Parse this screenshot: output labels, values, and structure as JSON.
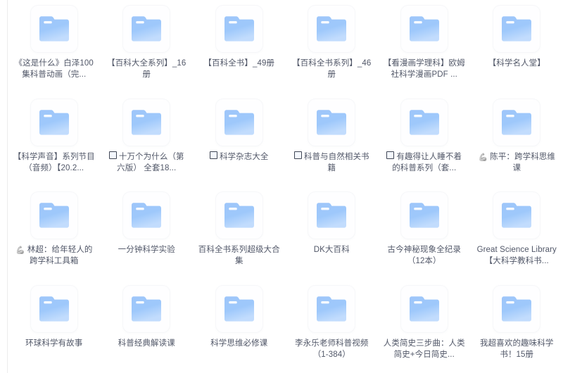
{
  "view": {
    "layout": "icon-grid",
    "columns": 6,
    "rows": 4,
    "background_color": "#ffffff",
    "divider_color": "#ececec",
    "label_color": "#515768",
    "folder_color_light": "#a9cdfb",
    "folder_color_dark": "#7fb4f7"
  },
  "items": [
    {
      "id": 1,
      "icon": "folder-icon",
      "prefix": "",
      "prefix_type": "none",
      "label": "《这是什么》白泽100集科普动画（完..."
    },
    {
      "id": 2,
      "icon": "folder-icon",
      "prefix": "",
      "prefix_type": "none",
      "label": "【百科大全系列】_16册"
    },
    {
      "id": 3,
      "icon": "folder-icon",
      "prefix": "",
      "prefix_type": "none",
      "label": "【百科全书】_49册"
    },
    {
      "id": 4,
      "icon": "folder-icon",
      "prefix": "",
      "prefix_type": "none",
      "label": "【百科全书系列】_46册"
    },
    {
      "id": 5,
      "icon": "folder-icon",
      "prefix": "",
      "prefix_type": "none",
      "label": "【看漫画学理科】欧姆社科学漫画PDF ..."
    },
    {
      "id": 6,
      "icon": "folder-icon",
      "prefix": "",
      "prefix_type": "none",
      "label": "【科学名人堂】"
    },
    {
      "id": 7,
      "icon": "folder-icon",
      "prefix": "",
      "prefix_type": "none",
      "label": "【科学声音】系列节目（音频）【20.2..."
    },
    {
      "id": 8,
      "icon": "folder-icon",
      "prefix": "□",
      "prefix_type": "checkbox",
      "label": "十万个为什么（第六版） 全套18..."
    },
    {
      "id": 9,
      "icon": "folder-icon",
      "prefix": "□",
      "prefix_type": "checkbox",
      "label": "科学杂志大全"
    },
    {
      "id": 10,
      "icon": "folder-icon",
      "prefix": "□",
      "prefix_type": "checkbox",
      "label": "科普与自然相关书籍"
    },
    {
      "id": 11,
      "icon": "folder-icon",
      "prefix": "□",
      "prefix_type": "checkbox",
      "label": "有趣得让人睡不着的科普系列（套..."
    },
    {
      "id": 12,
      "icon": "folder-icon",
      "prefix": "💪",
      "prefix_type": "emoji",
      "label": "陈平：跨学科思维课"
    },
    {
      "id": 13,
      "icon": "folder-icon",
      "prefix": "💪",
      "prefix_type": "emoji",
      "label": "林超：给年轻人的跨学科工具箱"
    },
    {
      "id": 14,
      "icon": "folder-icon",
      "prefix": "",
      "prefix_type": "none",
      "label": "一分钟科学实验"
    },
    {
      "id": 15,
      "icon": "folder-icon",
      "prefix": "",
      "prefix_type": "none",
      "label": "百科全书系列超级大合集"
    },
    {
      "id": 16,
      "icon": "folder-icon",
      "prefix": "",
      "prefix_type": "none",
      "label": "DK大百科"
    },
    {
      "id": 17,
      "icon": "folder-icon",
      "prefix": "",
      "prefix_type": "none",
      "label": "古今神秘现象全纪录（12本）"
    },
    {
      "id": 18,
      "icon": "folder-icon",
      "prefix": "",
      "prefix_type": "none",
      "label": "Great Science Library【大科学教科书..."
    },
    {
      "id": 19,
      "icon": "folder-icon",
      "prefix": "",
      "prefix_type": "none",
      "label": "环球科学有故事"
    },
    {
      "id": 20,
      "icon": "folder-icon",
      "prefix": "",
      "prefix_type": "none",
      "label": "科普经典解读课"
    },
    {
      "id": 21,
      "icon": "folder-icon",
      "prefix": "",
      "prefix_type": "none",
      "label": "科学思维必修课"
    },
    {
      "id": 22,
      "icon": "folder-icon",
      "prefix": "",
      "prefix_type": "none",
      "label": "李永乐老师科普视频（1-384）"
    },
    {
      "id": 23,
      "icon": "folder-icon",
      "prefix": "",
      "prefix_type": "none",
      "label": "人类简史三步曲：人类简史+今日简史..."
    },
    {
      "id": 24,
      "icon": "folder-icon",
      "prefix": "",
      "prefix_type": "none",
      "label": "我超喜欢的趣味科学书！15册"
    }
  ]
}
